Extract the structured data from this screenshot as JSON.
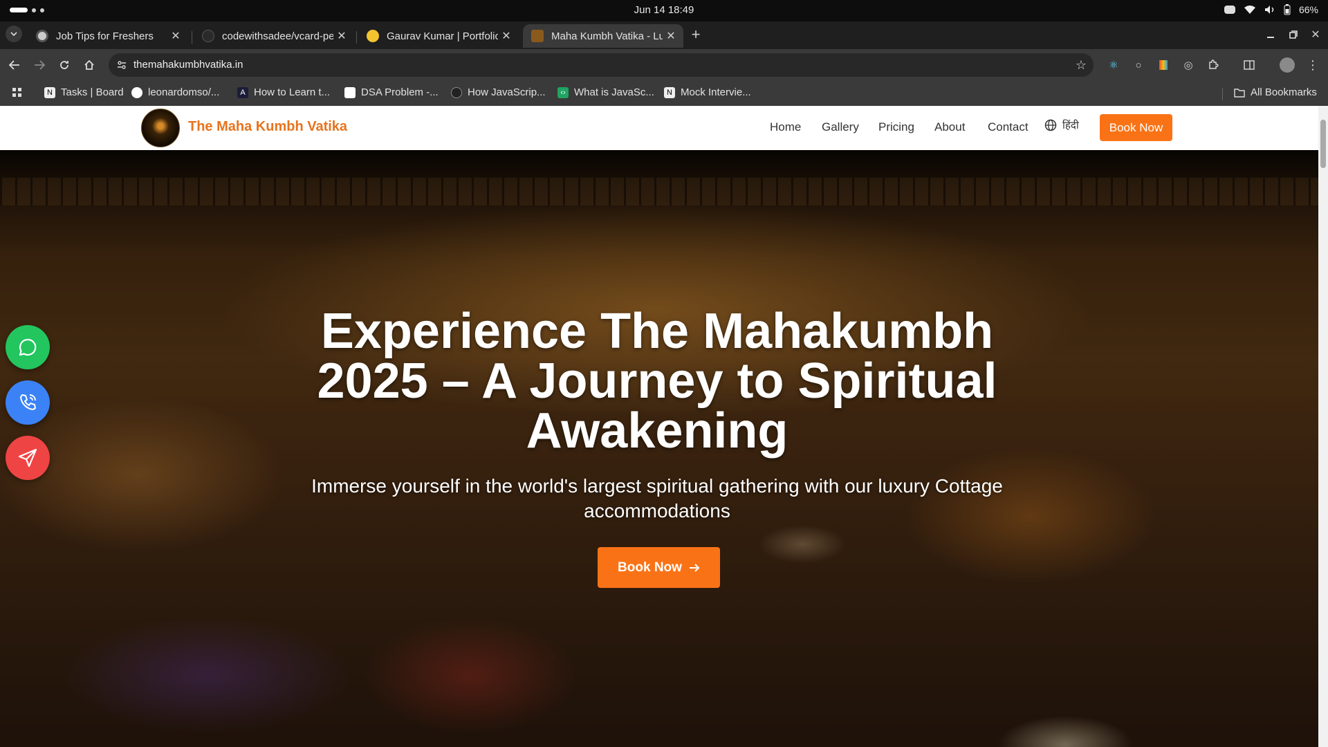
{
  "os": {
    "clock": "Jun 14  18:49",
    "battery": "66%"
  },
  "tabs": [
    {
      "title": "Job Tips for Freshers",
      "active": false
    },
    {
      "title": "codewithsadee/vcard-pe",
      "active": false
    },
    {
      "title": "Gaurav Kumar | Portfolio",
      "active": false
    },
    {
      "title": "Maha Kumbh Vatika - Lu",
      "active": true
    }
  ],
  "address": {
    "url": "themahakumbhvatika.in"
  },
  "bookmarks": {
    "items": [
      {
        "label": "Tasks | Board",
        "icon": "notion-icon"
      },
      {
        "label": "leonardomso/...",
        "icon": "github-icon"
      },
      {
        "label": "How to Learn t...",
        "icon": "a-icon"
      },
      {
        "label": "DSA Problem -...",
        "icon": "doc-icon"
      },
      {
        "label": "How JavaScrip...",
        "icon": "site-icon"
      },
      {
        "label": "What is JavaSc...",
        "icon": "code-icon"
      },
      {
        "label": "Mock Intervie...",
        "icon": "notion-icon"
      }
    ],
    "all_label": "All Bookmarks"
  },
  "site": {
    "name": "The Maha Kumbh Vatika",
    "nav": [
      "Home",
      "Gallery",
      "Pricing",
      "About",
      "Contact"
    ],
    "lang": "हिंदी",
    "book_label": "Book Now"
  },
  "hero": {
    "title": "Experience The Mahakumbh 2025 – A Journey to Spiritual Awakening",
    "subtitle": "Immerse yourself in the world's largest spiritual gathering with our luxury Cottage accommodations",
    "cta": "Book Now"
  },
  "colors": {
    "accent": "#f97316",
    "brand_text": "#e8731d",
    "whatsapp": "#22c55e",
    "phone": "#3b82f6",
    "send": "#ef4444"
  }
}
